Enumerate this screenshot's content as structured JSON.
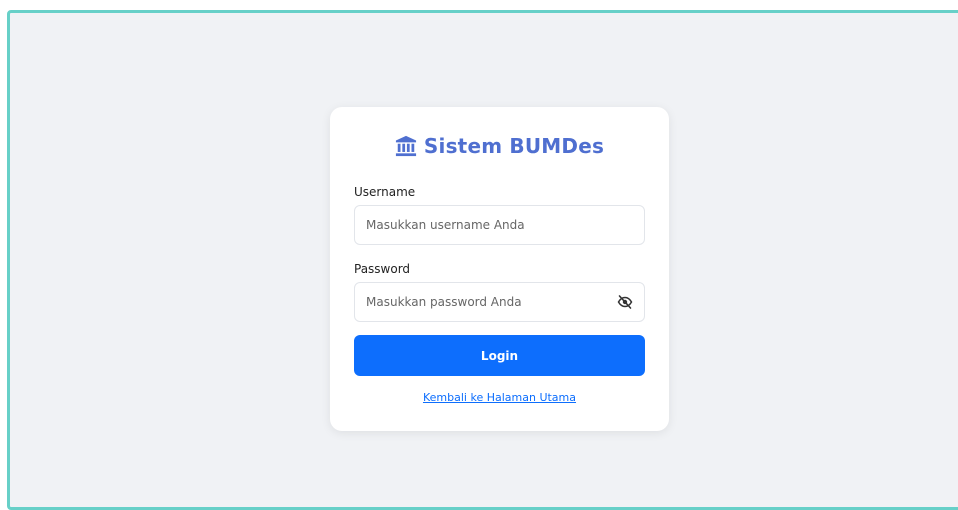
{
  "login": {
    "title": "Sistem BUMDes",
    "title_icon": "bank-icon",
    "username_label": "Username",
    "username_placeholder": "Masukkan username Anda",
    "username_value": "",
    "password_label": "Password",
    "password_placeholder": "Masukkan password Anda",
    "password_value": "",
    "password_toggle_icon": "eye-slash-icon",
    "login_button": "Login",
    "back_link": "Kembali ke Halaman Utama"
  },
  "colors": {
    "title": "#4f6fd0",
    "primary": "#0d6efd",
    "page_bg": "#f0f2f5",
    "frame_border": "#67d0c8"
  }
}
